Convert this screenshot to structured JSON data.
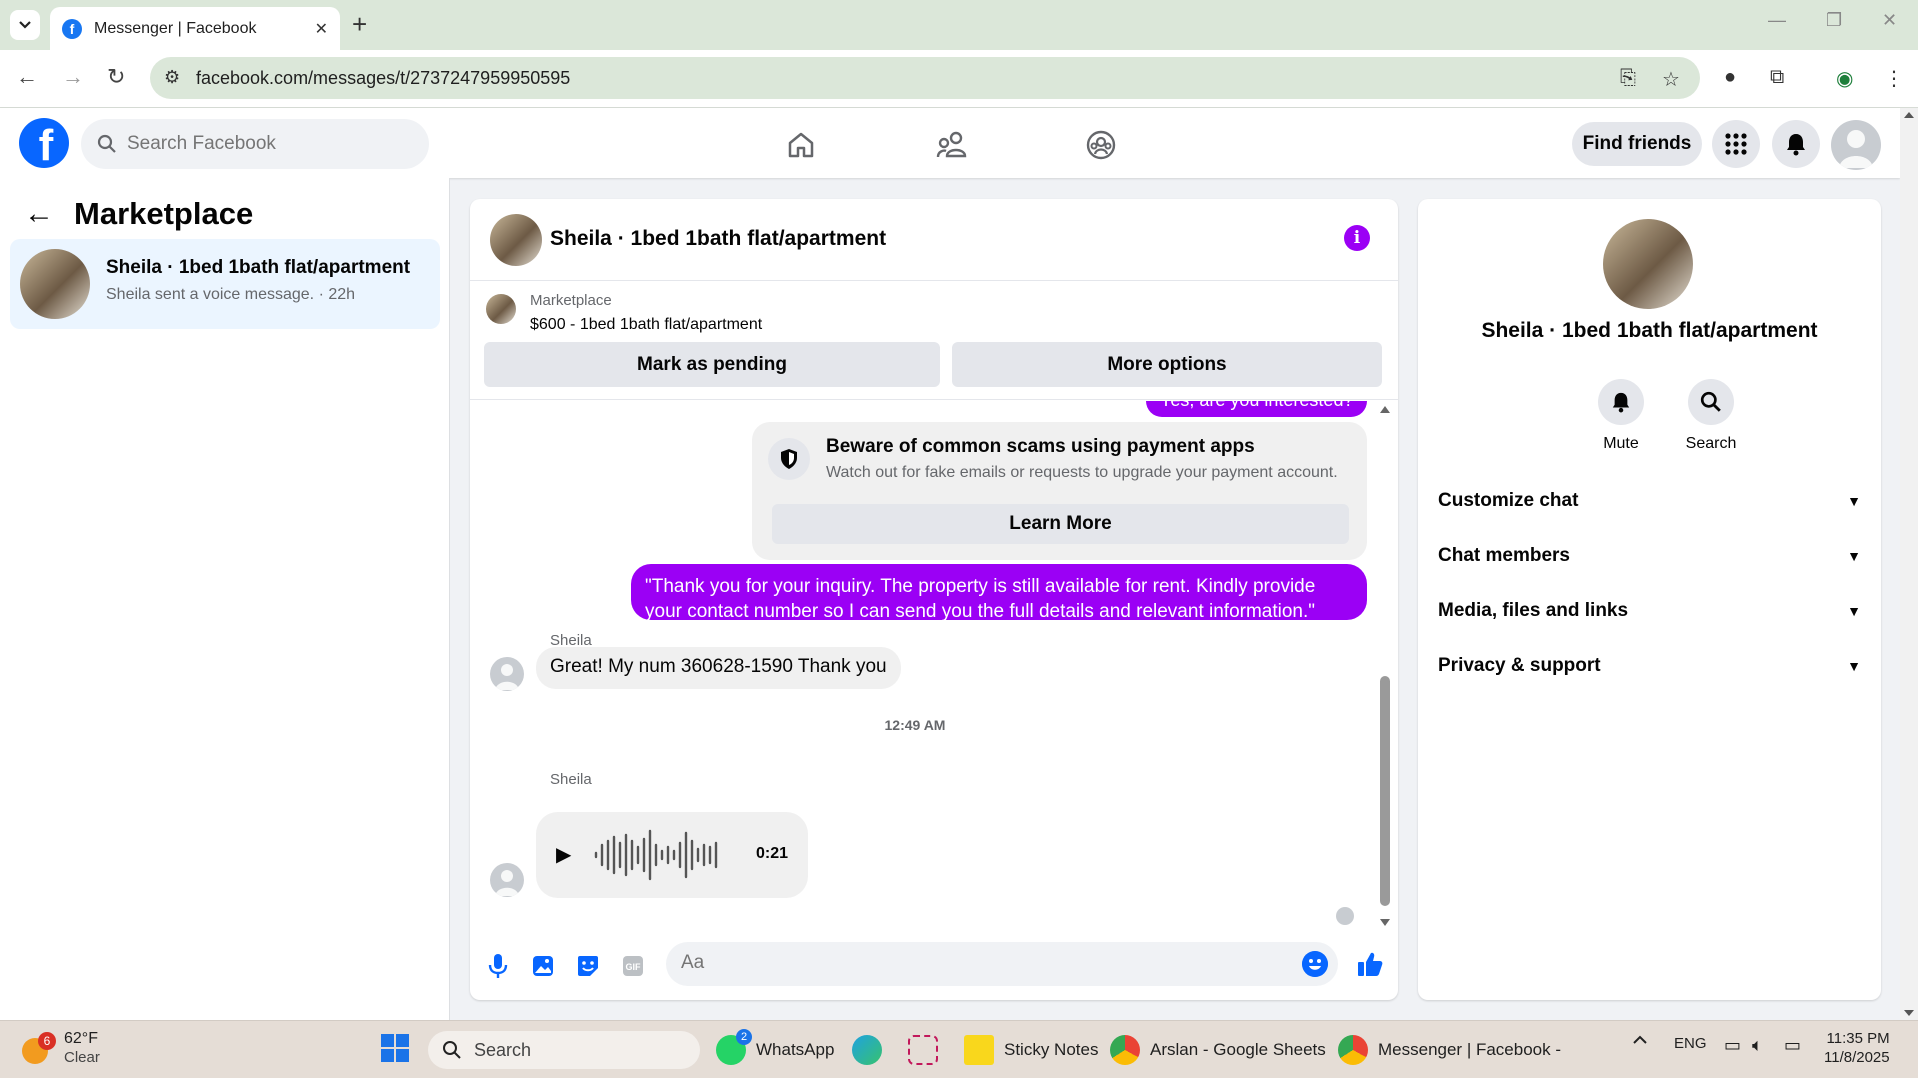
{
  "browser": {
    "tab_title": "Messenger | Facebook",
    "url": "facebook.com/messages/t/2737247959950595"
  },
  "header": {
    "logo_letter": "f",
    "search_placeholder": "Search Facebook",
    "find_friends": "Find friends"
  },
  "sidebar": {
    "title": "Marketplace",
    "conversation": {
      "name": "Sheila · 1bed 1bath flat/apartment",
      "preview": "Sheila sent a voice message. · 22h"
    }
  },
  "chat": {
    "title": "Sheila · 1bed 1bath flat/apartment",
    "marketplace_label": "Marketplace",
    "listing": "$600 - 1bed 1bath flat/apartment",
    "mark_pending": "Mark as pending",
    "more_options": "More options",
    "partial_message": "Yes, are you interested?",
    "scam_title": "Beware of common scams using payment apps",
    "scam_text": "Watch out for fake emails or requests to upgrade your payment account.",
    "learn_more": "Learn More",
    "outgoing_message": "\"Thank you for your inquiry. The property is still available for rent. Kindly provide your contact number so I can send you the full details and relevant information.\"",
    "sender_1": "Sheila",
    "incoming_message": "Great! My num 360628-1590 Thank you",
    "timestamp": "12:49 AM",
    "sender_2": "Sheila",
    "voice_duration": "0:21",
    "composer_placeholder": "Aa"
  },
  "info_panel": {
    "name": "Sheila · 1bed 1bath flat/apartment",
    "mute": "Mute",
    "search": "Search",
    "sections": [
      "Customize chat",
      "Chat members",
      "Media, files and links",
      "Privacy & support"
    ]
  },
  "taskbar": {
    "weather_temp": "62°F",
    "weather_cond": "Clear",
    "weather_badge": "6",
    "search": "Search",
    "whatsapp": "WhatsApp",
    "whatsapp_badge": "2",
    "sticky": "Sticky Notes",
    "sheets": "Arslan - Google Sheets",
    "messenger": "Messenger | Facebook -",
    "lang": "ENG",
    "time": "11:35 PM",
    "date": "11/8/2025"
  },
  "colors": {
    "accent": "#9b00f5",
    "fb_blue": "#0866ff",
    "selected": "#ebf5ff"
  }
}
